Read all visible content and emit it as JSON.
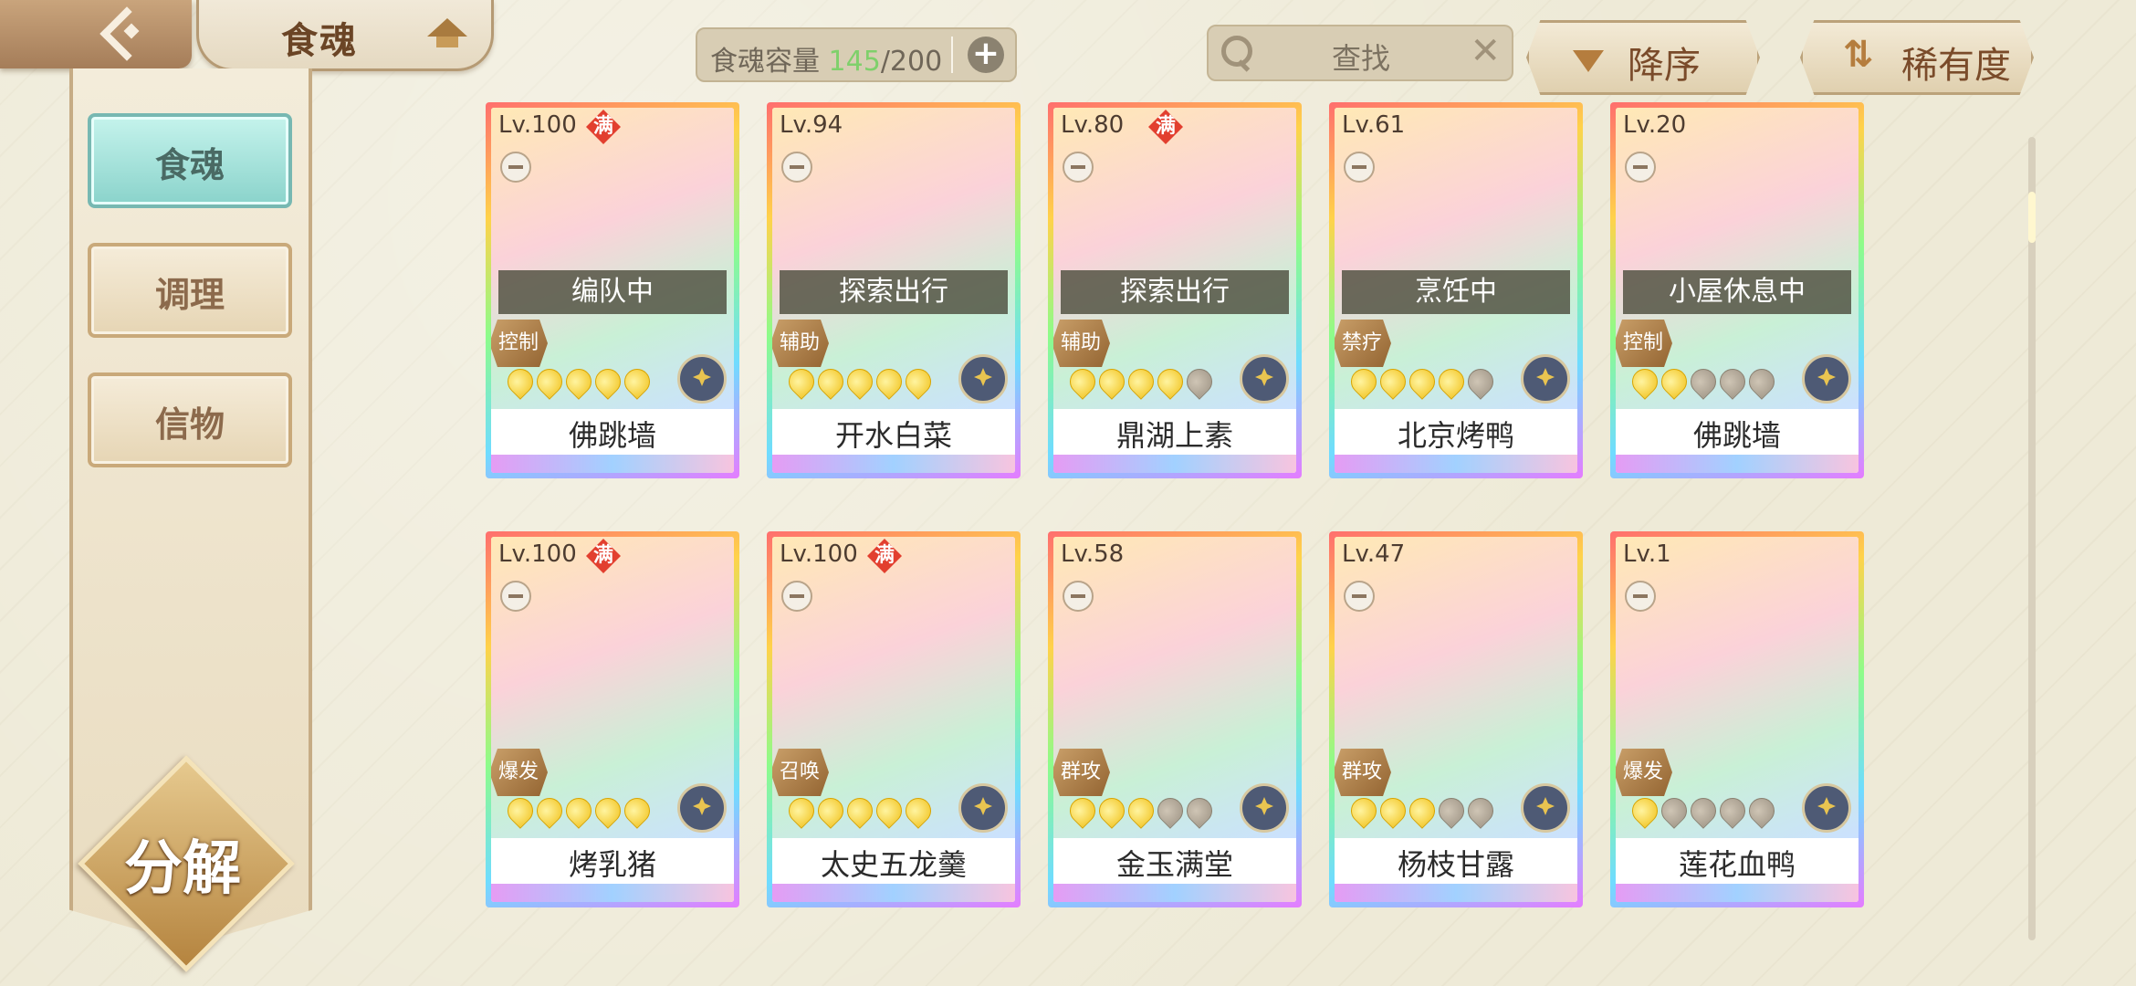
{
  "header": {
    "title": "食魂",
    "capacity_label": "食魂容量 ",
    "capacity_current": "145",
    "capacity_total": "/200",
    "search_placeholder": "查找",
    "sort_order": "降序",
    "sort_by": "稀有度"
  },
  "sidebar": {
    "tabs": [
      {
        "label": "食魂",
        "active": true
      },
      {
        "label": "调理",
        "active": false
      },
      {
        "label": "信物",
        "active": false
      }
    ],
    "decompose_label": "分解"
  },
  "cards": [
    {
      "level": "Lv.100",
      "full": "满",
      "status": "编队中",
      "role": "控制",
      "stars": 5,
      "name": "佛跳墙"
    },
    {
      "level": "Lv.94",
      "full": "",
      "status": "探索出行",
      "role": "辅助",
      "stars": 5,
      "name": "开水白菜"
    },
    {
      "level": "Lv.80",
      "full": "满",
      "status": "探索出行",
      "role": "辅助",
      "stars": 4,
      "name": "鼎湖上素"
    },
    {
      "level": "Lv.61",
      "full": "",
      "status": "烹饪中",
      "role": "禁疗",
      "stars": 4,
      "name": "北京烤鸭"
    },
    {
      "level": "Lv.20",
      "full": "",
      "status": "小屋休息中",
      "role": "控制",
      "stars": 2,
      "name": "佛跳墙"
    },
    {
      "level": "Lv.100",
      "full": "满",
      "status": "",
      "role": "爆发",
      "stars": 5,
      "name": "烤乳猪"
    },
    {
      "level": "Lv.100",
      "full": "满",
      "status": "",
      "role": "召唤",
      "stars": 5,
      "name": "太史五龙羹"
    },
    {
      "level": "Lv.58",
      "full": "",
      "status": "",
      "role": "群攻",
      "stars": 3,
      "name": "金玉满堂"
    },
    {
      "level": "Lv.47",
      "full": "",
      "status": "",
      "role": "群攻",
      "stars": 3,
      "name": "杨枝甘露"
    },
    {
      "level": "Lv.1",
      "full": "",
      "status": "",
      "role": "爆发",
      "stars": 1,
      "name": "莲花血鸭"
    }
  ],
  "colors": {
    "accent_teal": "#8ad3cb",
    "capacity_green": "#7fd06b",
    "full_badge_red": "#e23f2f"
  }
}
